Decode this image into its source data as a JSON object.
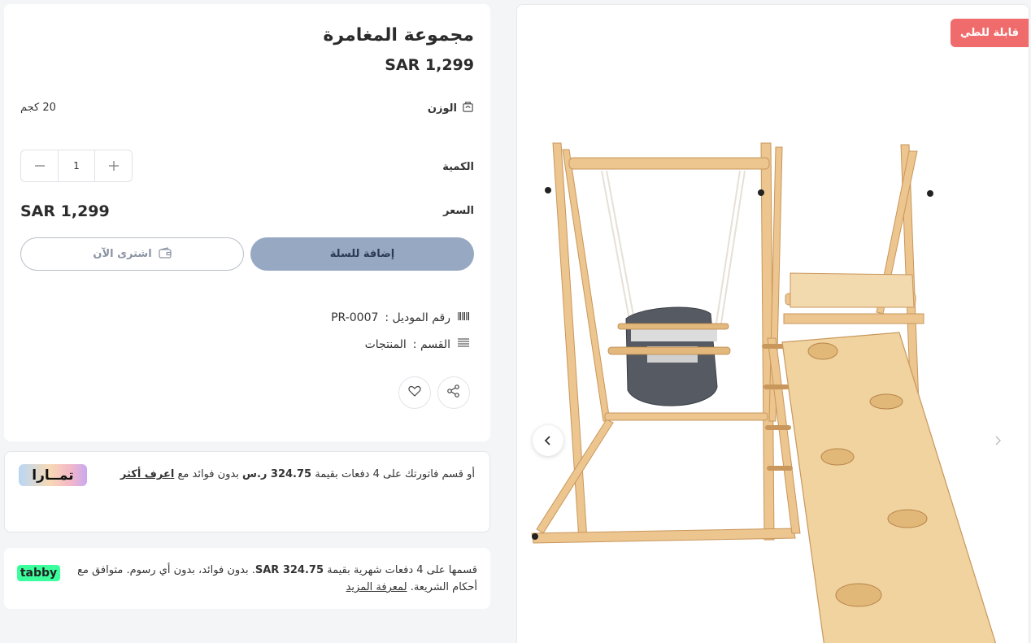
{
  "product": {
    "title": "مجموعة المغامرة",
    "price_top": "SAR 1,299",
    "weight_label": "الوزن",
    "weight_value": "20 كجم",
    "quantity_label": "الكمية",
    "quantity_value": "1",
    "price_label": "السعر",
    "price_value": "SAR 1,299",
    "add_to_cart": "إضافة للسلة",
    "buy_now": "اشترى الآن",
    "model_label": "رقم الموديل :",
    "model_value": "PR-0007",
    "category_label": "القسم :",
    "category_value": "المنتجات"
  },
  "tamara": {
    "text_before": "أو قسم فاتورتك على 4 دفعات بقيمة",
    "amount": "324.75 ر.س",
    "text_after": "بدون فوائد مع",
    "link": "اعرف أكثر",
    "logo": "تمــارا"
  },
  "tabby": {
    "text_before": "قسمها على 4 دفعات شهرية بقيمة",
    "amount": "SAR 324.75",
    "text_after": ". بدون فوائد، بدون أي رسوم. متوافق مع أحكام الشريعة.",
    "link": "لمعرفة المزيد",
    "logo": "tabby"
  },
  "gallery": {
    "badge": "قابلة للطي"
  },
  "colors": {
    "add_to_cart_bg": "#97a8c3",
    "badge_bg": "#f06c6c",
    "tabby_green": "#3bff9d"
  },
  "icons": {
    "weight": "scale-icon",
    "model": "barcode-icon",
    "category": "list-icon",
    "share": "share-icon",
    "wishlist": "heart-icon",
    "buy_now": "wallet-icon"
  }
}
